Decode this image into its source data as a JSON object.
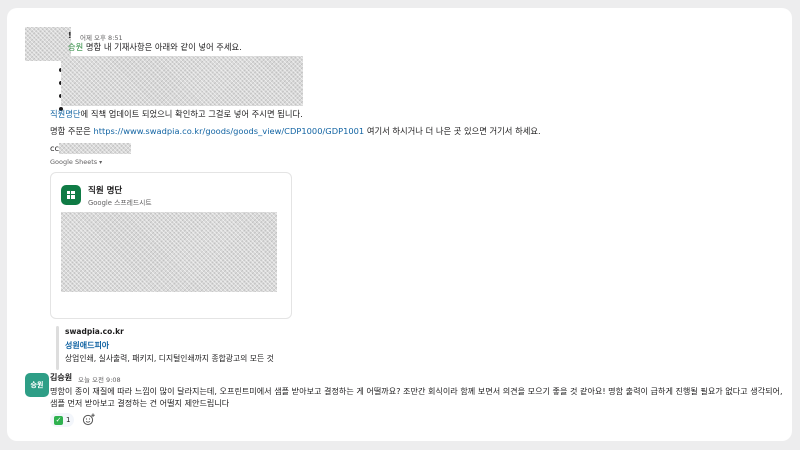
{
  "message1": {
    "sender_visible_tail": "!",
    "time": "어제 오후 8:51",
    "line1_mention": "승원",
    "line1_text": " 명함 내 기재사항은 아래와 같이 넣어 주세요.",
    "line2_link": "직원명단",
    "line2_text": "에 직책 업데이트 되었으니 확인하고 그걸로 넣어 주시면 됩니다.",
    "line3_prefix": "명함 주문은 ",
    "line3_link": "https://www.swadpia.co.kr/goods/goods_view/CDP1000/GDP1001",
    "line3_suffix": " 여기서 하시거나 더 나은 곳 있으면 거기서 하세요.",
    "cc_label": "cc."
  },
  "attachment": {
    "caption": "Google Sheets",
    "title": "직원 명단",
    "subtitle": "Google 스프레드시트",
    "icon": "google-sheets-icon"
  },
  "unfurl": {
    "site": "swadpia.co.kr",
    "title": "성원애드피아",
    "description": "상업인쇄, 실사출력, 패키지, 디지털인쇄까지 종합광고의 모든 것"
  },
  "message2": {
    "avatar_text": "승원",
    "sender": "김승원",
    "time": "오늘 오전 9:08",
    "text": "명함이 종이 재질에 따라 느낌이 많이 달라지는데, 오프린트미에서 샘플 받아보고 결정하는 게 어떨까요? 조만간 회식이라 함께 보면서 의견을 모으기 좋을 것 같아요! 명함 출력이 급하게 진행될 필요가 없다고 생각되어, 샘플 먼저 받아보고 결정하는 건 어떨지 제안드립니다",
    "reaction_count": "1"
  },
  "colors": {
    "link": "#1264a3",
    "mention": "#2b8a3e",
    "sheets_green": "#0f7b45",
    "avatar_teal": "#2e9e86"
  }
}
